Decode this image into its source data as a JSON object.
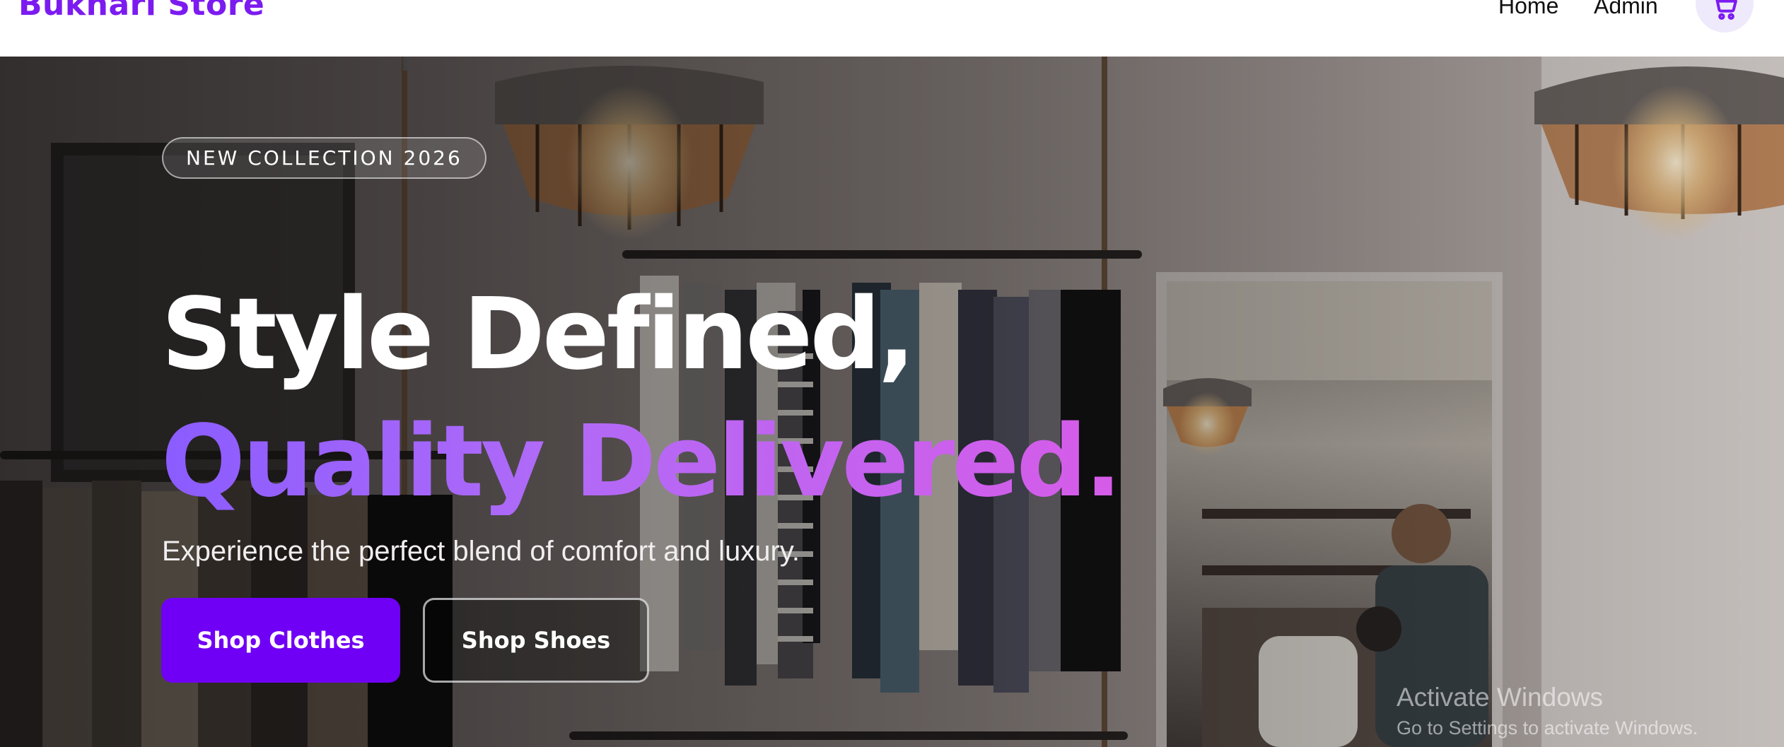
{
  "header": {
    "brand": "Bukhari Store",
    "nav": {
      "home": "Home",
      "admin": "Admin"
    },
    "cart_icon": "cart-icon",
    "colors": {
      "brand": "#7c1bf0",
      "cart_bg": "#efeafb"
    }
  },
  "hero": {
    "badge": "NEW COLLECTION 2026",
    "headline_line1": "Style Defined,",
    "headline_line2": "Quality Delivered.",
    "subtitle": "Experience the perfect blend of comfort and luxury.",
    "primary_button": "Shop Clothes",
    "secondary_button": "Shop Shoes",
    "colors": {
      "primary_button": "#7000f5",
      "headline_gradient_start": "#8a5cff",
      "headline_gradient_end": "#d65ce8"
    }
  },
  "watermark": {
    "title": "Activate Windows",
    "subtitle": "Go to Settings to activate Windows."
  }
}
